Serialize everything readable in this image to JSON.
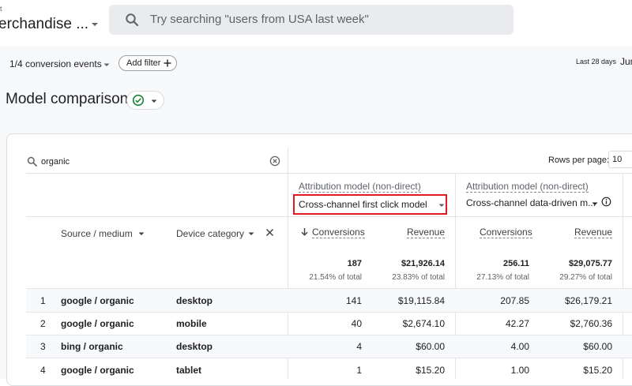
{
  "header": {
    "property_small": "t",
    "property_name": "erchandise ...",
    "search_placeholder": "Try searching \"users from USA last week\""
  },
  "filters": {
    "conversion_events": "1/4 conversion events",
    "add_filter": "Add filter",
    "date_label": "Last 28 days",
    "date_range": "Jun"
  },
  "page": {
    "title": "Model comparison"
  },
  "table": {
    "search_value": "organic",
    "rows_per_page_label": "Rows per page:",
    "rows_per_page_value": "10",
    "attribution_label": "Attribution model (non-direct)",
    "model_1": "Cross-channel first click model",
    "model_2": "Cross-channel data-driven m...",
    "headers": {
      "source_medium": "Source / medium",
      "device_category": "Device category",
      "conversions": "Conversions",
      "revenue": "Revenue"
    },
    "totals": {
      "m1_conversions": "187",
      "m1_conversions_pct": "21.54% of total",
      "m1_revenue": "$21,926.14",
      "m1_revenue_pct": "23.83% of total",
      "m2_conversions": "256.11",
      "m2_conversions_pct": "27.13% of total",
      "m2_revenue": "$29,075.77",
      "m2_revenue_pct": "29.27% of total"
    },
    "rows": [
      {
        "index": "1",
        "source": "google / organic",
        "device": "desktop",
        "c1": "141",
        "r1": "$19,115.84",
        "c2": "207.85",
        "r2": "$26,179.21"
      },
      {
        "index": "2",
        "source": "google / organic",
        "device": "mobile",
        "c1": "40",
        "r1": "$2,674.10",
        "c2": "42.27",
        "r2": "$2,760.36"
      },
      {
        "index": "3",
        "source": "bing / organic",
        "device": "desktop",
        "c1": "4",
        "r1": "$60.00",
        "c2": "4.00",
        "r2": "$60.00"
      },
      {
        "index": "4",
        "source": "google / organic",
        "device": "tablet",
        "c1": "1",
        "r1": "$15.20",
        "c2": "1.00",
        "r2": "$15.20"
      }
    ]
  },
  "colors": {
    "highlight": "#e01b24",
    "check_green": "#188038",
    "icon_gray": "#5f6368"
  }
}
